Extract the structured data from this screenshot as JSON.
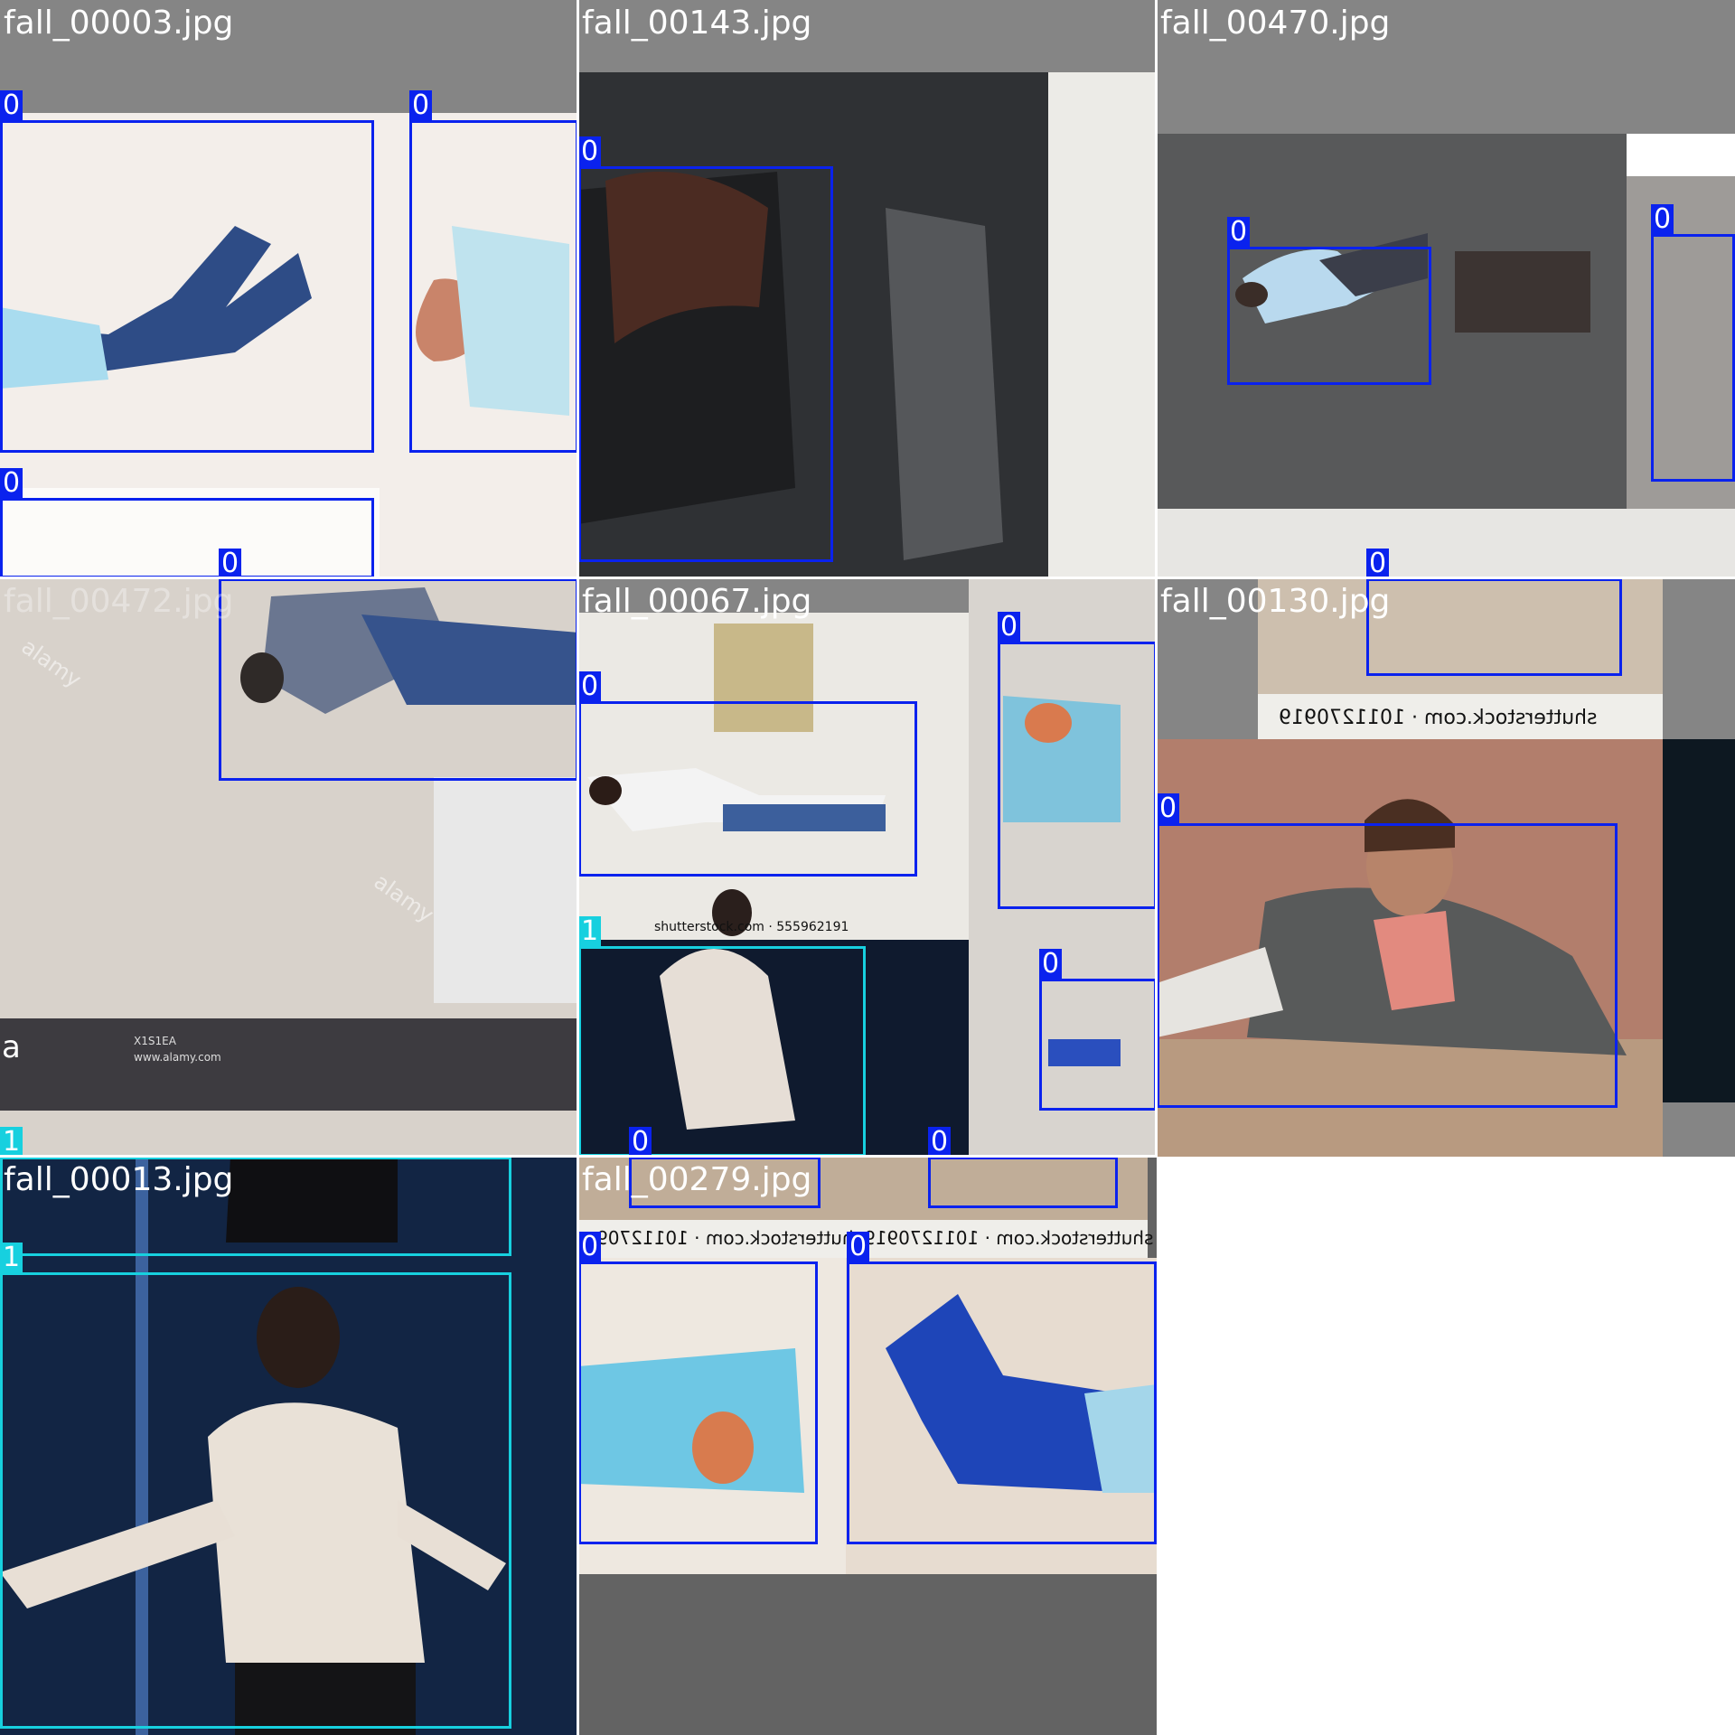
{
  "mosaic": {
    "tiles": [
      {
        "id": "t0",
        "title": "fall_00003.jpg"
      },
      {
        "id": "t1",
        "title": "fall_00143.jpg"
      },
      {
        "id": "t2",
        "title": "fall_00470.jpg"
      },
      {
        "id": "t3",
        "title": "fall_00472.jpg"
      },
      {
        "id": "t4",
        "title": "fall_00067.jpg"
      },
      {
        "id": "t5",
        "title": "fall_00130.jpg"
      },
      {
        "id": "t6",
        "title": "fall_00013.jpg"
      },
      {
        "id": "t7",
        "title": "fall_00279.jpg"
      }
    ],
    "class_labels": {
      "fall": "0",
      "person": "1"
    },
    "colors": {
      "class_0": "#0a22ee",
      "class_1": "#17d0df",
      "title_bar": "#858585"
    },
    "watermarks": {
      "shutterstock_a": "shutterstock.com · 555962191",
      "shutterstock_b": "shutterstock.com · 1011270919",
      "shutterstock_c": "shutterstock.com · 10112709",
      "alamy": "alamy",
      "alamy_logo": "a",
      "alamy_code": "X1S1EA",
      "alamy_url": "www.alamy.com"
    }
  }
}
